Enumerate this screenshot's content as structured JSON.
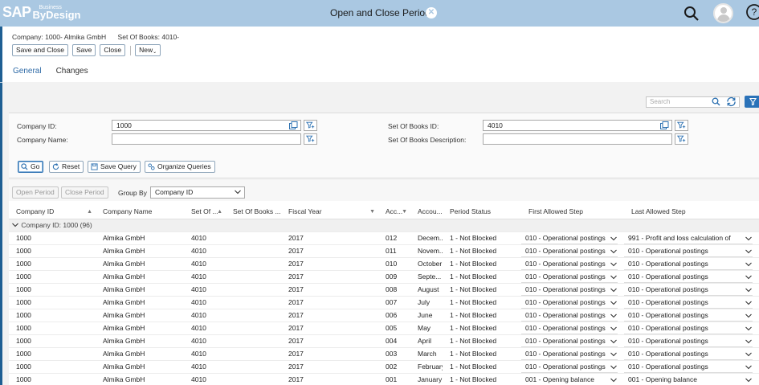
{
  "shell": {
    "logo_main": "SAP",
    "logo_small": "Business",
    "logo_sub": "ByDesign",
    "title": "Open and Close Periods"
  },
  "context": {
    "company": "Company: 1000- Almika GmbH",
    "set_of_books": "Set Of Books: 4010-"
  },
  "toolbar": {
    "save_and_close": "Save and Close",
    "save": "Save",
    "close": "Close",
    "new": "New"
  },
  "tabs": [
    {
      "label": "General",
      "active": true
    },
    {
      "label": "Changes",
      "active": false
    }
  ],
  "search": {
    "placeholder": "Search"
  },
  "filters": {
    "company_id_label": "Company ID:",
    "company_id_value": "1000",
    "company_name_label": "Company Name:",
    "company_name_value": "",
    "sob_id_label": "Set Of Books ID:",
    "sob_id_value": "4010",
    "sob_desc_label": "Set Of Books Description:",
    "sob_desc_value": ""
  },
  "query_buttons": {
    "go": "Go",
    "reset": "Reset",
    "save_query": "Save Query",
    "organize": "Organize Queries"
  },
  "table_toolbar": {
    "open_period": "Open Period",
    "close_period": "Close Period",
    "group_by_label": "Group By",
    "group_by_value": "Company ID"
  },
  "columns": [
    "Company ID",
    "Company Name",
    "Set Of ...",
    "Set Of Books ...",
    "Fiscal Year",
    "Acc...",
    "Accou...",
    "Period Status",
    "First Allowed Step",
    "Last Allowed Step"
  ],
  "group_row": "Company ID: 1000 (96)",
  "rows": [
    [
      "1000",
      "Almika GmbH",
      "4010",
      "",
      "2017",
      "012",
      "Decem...",
      "1 - Not Blocked",
      "010 - Operational postings",
      "991 - Profit and loss calculation of"
    ],
    [
      "1000",
      "Almika GmbH",
      "4010",
      "",
      "2017",
      "011",
      "Novem...",
      "1 - Not Blocked",
      "010 - Operational postings",
      "010 - Operational postings"
    ],
    [
      "1000",
      "Almika GmbH",
      "4010",
      "",
      "2017",
      "010",
      "October",
      "1 - Not Blocked",
      "010 - Operational postings",
      "010 - Operational postings"
    ],
    [
      "1000",
      "Almika GmbH",
      "4010",
      "",
      "2017",
      "009",
      "Septe...",
      "1 - Not Blocked",
      "010 - Operational postings",
      "010 - Operational postings"
    ],
    [
      "1000",
      "Almika GmbH",
      "4010",
      "",
      "2017",
      "008",
      "August",
      "1 - Not Blocked",
      "010 - Operational postings",
      "010 - Operational postings"
    ],
    [
      "1000",
      "Almika GmbH",
      "4010",
      "",
      "2017",
      "007",
      "July",
      "1 - Not Blocked",
      "010 - Operational postings",
      "010 - Operational postings"
    ],
    [
      "1000",
      "Almika GmbH",
      "4010",
      "",
      "2017",
      "006",
      "June",
      "1 - Not Blocked",
      "010 - Operational postings",
      "010 - Operational postings"
    ],
    [
      "1000",
      "Almika GmbH",
      "4010",
      "",
      "2017",
      "005",
      "May",
      "1 - Not Blocked",
      "010 - Operational postings",
      "010 - Operational postings"
    ],
    [
      "1000",
      "Almika GmbH",
      "4010",
      "",
      "2017",
      "004",
      "April",
      "1 - Not Blocked",
      "010 - Operational postings",
      "010 - Operational postings"
    ],
    [
      "1000",
      "Almika GmbH",
      "4010",
      "",
      "2017",
      "003",
      "March",
      "1 - Not Blocked",
      "010 - Operational postings",
      "010 - Operational postings"
    ],
    [
      "1000",
      "Almika GmbH",
      "4010",
      "",
      "2017",
      "002",
      "February",
      "1 - Not Blocked",
      "010 - Operational postings",
      "010 - Operational postings"
    ],
    [
      "1000",
      "Almika GmbH",
      "4010",
      "",
      "2017",
      "001",
      "January",
      "1 - Not Blocked",
      "001 - Opening balance",
      "001 - Opening balance"
    ]
  ]
}
